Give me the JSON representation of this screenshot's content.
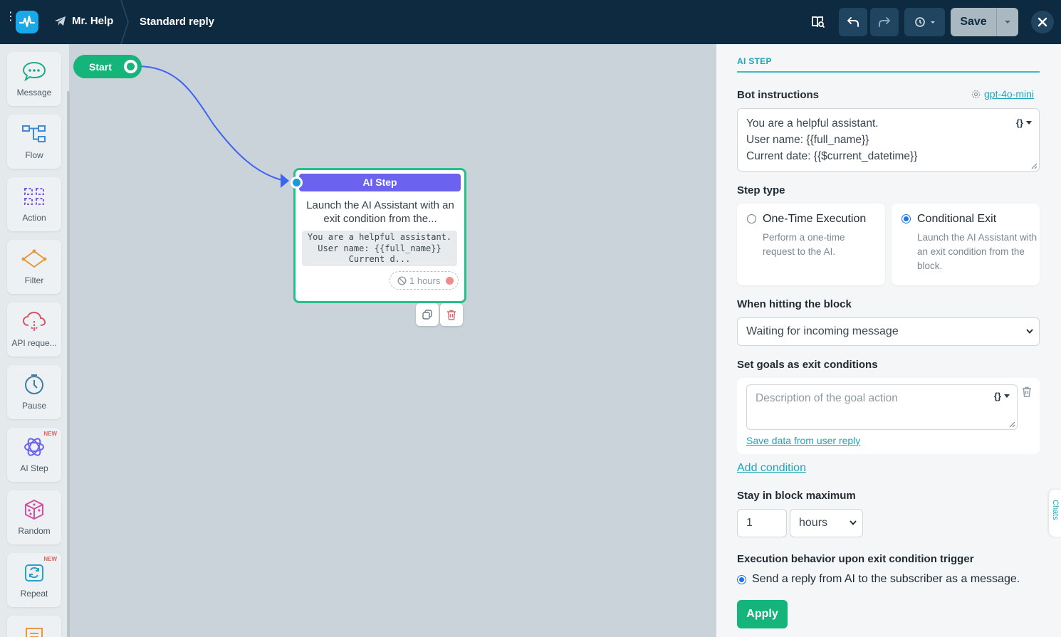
{
  "header": {
    "project": "Mr. Help",
    "flow_name": "Standard reply",
    "save_label": "Save"
  },
  "palette": {
    "items": [
      {
        "label": "Message",
        "icon": "chat-bubble-icon",
        "new": ""
      },
      {
        "label": "Flow",
        "icon": "flow-icon",
        "new": ""
      },
      {
        "label": "Action",
        "icon": "action-icon",
        "new": ""
      },
      {
        "label": "Filter",
        "icon": "filter-icon",
        "new": ""
      },
      {
        "label": "API reque...",
        "icon": "cloud-icon",
        "new": ""
      },
      {
        "label": "Pause",
        "icon": "clock-icon",
        "new": ""
      },
      {
        "label": "AI Step",
        "icon": "ai-orbit-icon",
        "new": "NEW"
      },
      {
        "label": "Random",
        "icon": "dice-icon",
        "new": ""
      },
      {
        "label": "Repeat",
        "icon": "repeat-icon",
        "new": "NEW"
      }
    ]
  },
  "canvas": {
    "start_label": "Start",
    "node": {
      "title": "AI Step",
      "description": "Launch the AI Assistant with an exit condition from the...",
      "code_preview": "You are a helpful assistant. User name: {{full_name}} Current d...",
      "timer": "1 hours"
    }
  },
  "panel": {
    "tab": "AI STEP",
    "bot_instructions_label": "Bot instructions",
    "model": "gpt-4o-mini",
    "instructions": {
      "line1": "You are a helpful assistant.",
      "line2": "User name:  {{full_name}}",
      "line3": "Current date:  {{$current_datetime}}"
    },
    "var_button": "{}",
    "step_type_label": "Step type",
    "step_types": [
      {
        "title": "One-Time Execution",
        "desc": "Perform a one-time request to the AI.",
        "selected": false
      },
      {
        "title": "Conditional Exit",
        "desc": "Launch the AI Assistant with an exit condition from the block.",
        "selected": true
      }
    ],
    "hitting_label": "When hitting the block",
    "hitting_value": "Waiting for incoming message",
    "goals_label": "Set goals as exit conditions",
    "goal_placeholder": "Description of the goal action",
    "save_data_link": "Save data from user reply",
    "add_condition": "Add condition",
    "stay_label": "Stay in block maximum",
    "stay_value": "1",
    "stay_unit": "hours",
    "behavior_label": "Execution behavior upon exit condition trigger",
    "behavior_option": "Send a reply from AI to the subscriber as a message.",
    "apply_label": "Apply",
    "chats_tab": "Chats"
  },
  "colors": {
    "topbar": "#0d2a40",
    "accent_green": "#14b47a",
    "ai_purple": "#6b63f0",
    "link_teal": "#1ea6b8",
    "connector_blue": "#3c64f0"
  }
}
